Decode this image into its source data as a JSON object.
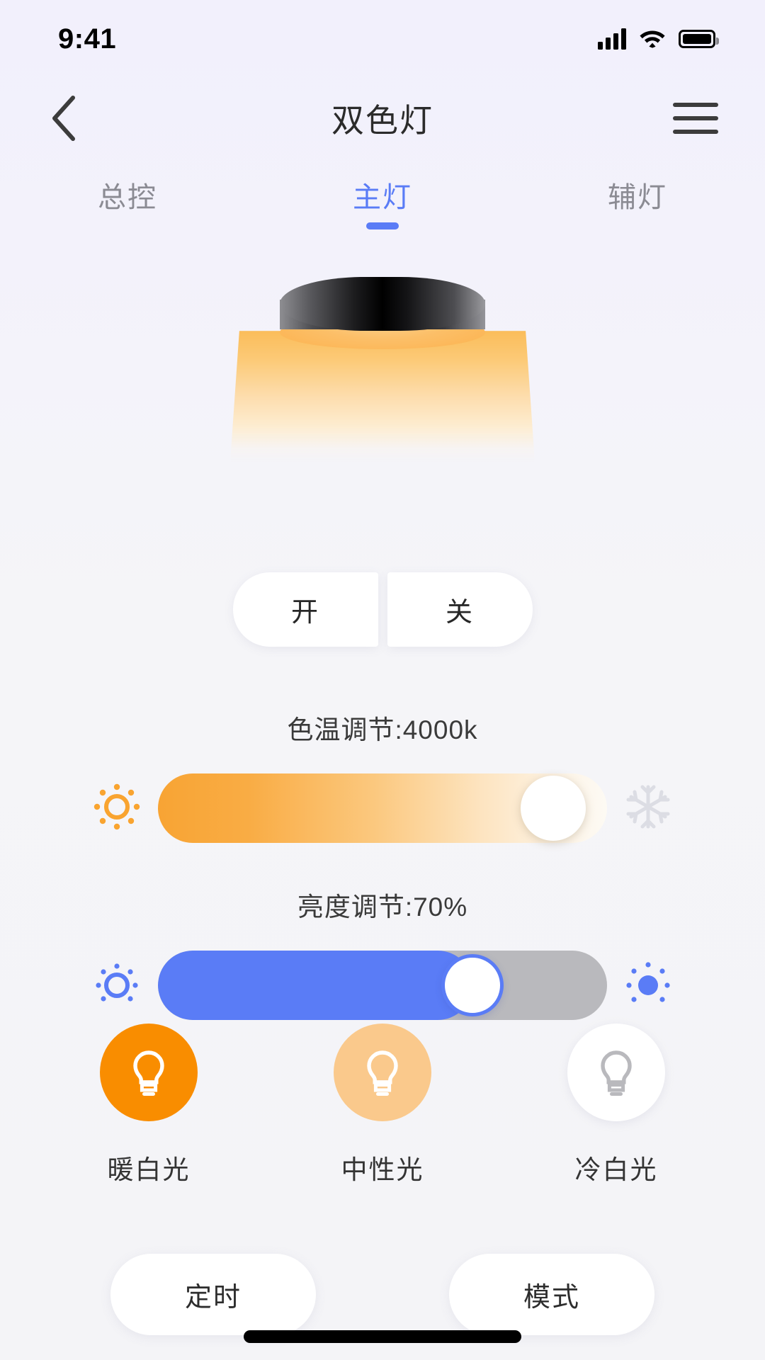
{
  "status_bar": {
    "time": "9:41",
    "signal_icon": "cellular-signal-icon",
    "wifi_icon": "wifi-icon",
    "battery_icon": "battery-full-icon"
  },
  "header": {
    "back_icon": "chevron-left-icon",
    "title": "双色灯",
    "menu_icon": "hamburger-menu-icon"
  },
  "tabs": [
    {
      "label": "总控",
      "active": false
    },
    {
      "label": "主灯",
      "active": true
    },
    {
      "label": "辅灯",
      "active": false
    }
  ],
  "lamp": {
    "illustration": "ceiling-lamp-illustration",
    "glow_color": "#fbb24e",
    "body_color": "#000000"
  },
  "power": {
    "on_label": "开",
    "off_label": "关"
  },
  "color_temperature": {
    "caption": "色温调节:4000k",
    "value": "4000k",
    "percent": 88,
    "left_icon": "sun-warm-icon",
    "right_icon": "snowflake-icon",
    "left_icon_color": "#f9a430",
    "right_icon_color": "#d9dae2"
  },
  "brightness": {
    "caption": "亮度调节:70%",
    "value": "70%",
    "percent": 70,
    "left_icon": "brightness-low-icon",
    "right_icon": "brightness-high-icon",
    "icon_color": "#5a7cf6",
    "fill_color": "#5a7cf6",
    "track_color": "#b9b9bd"
  },
  "presets": [
    {
      "label": "暖白光",
      "icon": "light-bulb-icon",
      "circle_color": "#f98d00",
      "bulb_color": "#ffffff"
    },
    {
      "label": "中性光",
      "icon": "light-bulb-icon",
      "circle_color": "#fac98c",
      "bulb_color": "#ffffff"
    },
    {
      "label": "冷白光",
      "icon": "light-bulb-icon",
      "circle_color": "#ffffff",
      "bulb_color": "#b9b9bd"
    }
  ],
  "bottom_actions": {
    "timer_label": "定时",
    "mode_label": "模式"
  },
  "theme": {
    "accent_blue": "#5a7cf6",
    "accent_orange": "#f98d00",
    "background": "#f4f3fb",
    "text_primary": "#2b2b2b",
    "text_muted": "#8b8b93"
  }
}
